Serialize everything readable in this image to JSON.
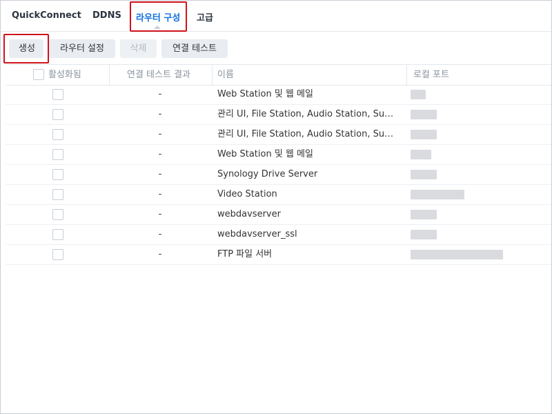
{
  "tabs": [
    {
      "label": "QuickConnect",
      "active": false
    },
    {
      "label": "DDNS",
      "active": false
    },
    {
      "label": "라우터 구성",
      "active": true
    },
    {
      "label": "고급",
      "active": false
    }
  ],
  "toolbar": {
    "create": "생성",
    "router_settings": "라우터 설정",
    "delete": "삭제",
    "test_connection": "연결 테스트"
  },
  "table": {
    "headers": {
      "enabled": "활성화됨",
      "result": "연결 테스트 결과",
      "name": "이름",
      "local_port": "로컬 포트"
    },
    "rows": [
      {
        "result": "-",
        "name": "Web Station 및 웹 메일",
        "port": "redacted"
      },
      {
        "result": "-",
        "name": "관리 UI, File Station, Audio Station, Su…",
        "port": "redacted"
      },
      {
        "result": "-",
        "name": "관리 UI, File Station, Audio Station, Su…",
        "port": "redacted"
      },
      {
        "result": "-",
        "name": "Web Station 및 웹 메일",
        "port": "redacted"
      },
      {
        "result": "-",
        "name": "Synology Drive Server",
        "port": "redacted"
      },
      {
        "result": "-",
        "name": "Video Station",
        "port": "redacted"
      },
      {
        "result": "-",
        "name": "webdavserver",
        "port": "redacted"
      },
      {
        "result": "-",
        "name": "webdavserver_ssl",
        "port": "redacted"
      },
      {
        "result": "-",
        "name": "FTP 파일 서버",
        "port": "redacted"
      }
    ]
  },
  "colors": {
    "active_tab": "#0f6fdc",
    "highlight": "#d0111b"
  }
}
